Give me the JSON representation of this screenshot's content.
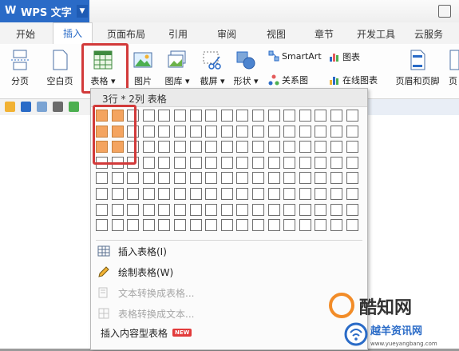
{
  "app": {
    "name": "WPS 文字",
    "logo": "W"
  },
  "tabs": [
    "开始",
    "插入",
    "页面布局",
    "引用",
    "审阅",
    "视图",
    "章节",
    "开发工具",
    "云服务"
  ],
  "active_tab": "插入",
  "ribbon": {
    "page_break": "分页",
    "blank_page": "空白页",
    "table": "表格",
    "picture": "图片",
    "gallery": "图库",
    "screenshot": "截屏",
    "shape": "形状",
    "smartart": "SmartArt",
    "chart": "图表",
    "relation": "关系图",
    "online_chart": "在线图表",
    "header_footer": "页眉和页脚",
    "page_partial": "页"
  },
  "dropdown": {
    "grid_label": "3行 * 2列 表格",
    "rows": 8,
    "cols": 17,
    "selected_rows": 3,
    "selected_cols": 2,
    "items": [
      {
        "label": "插入表格(I)",
        "enabled": true
      },
      {
        "label": "绘制表格(W)",
        "enabled": true
      },
      {
        "label": "文本转换成表格...",
        "enabled": false
      },
      {
        "label": "表格转换成文本...",
        "enabled": false
      },
      {
        "label": "插入内容型表格",
        "enabled": true,
        "badge": "NEW"
      }
    ]
  },
  "watermark": {
    "text": "酷知网",
    "subtext": "越羊资讯网",
    "url": "www.yueyangbang.com"
  },
  "colors": {
    "accent": "#2a6bc7",
    "highlight": "#d23a3a",
    "selected_cell": "#f4a460",
    "badge": "#e23b3b"
  }
}
